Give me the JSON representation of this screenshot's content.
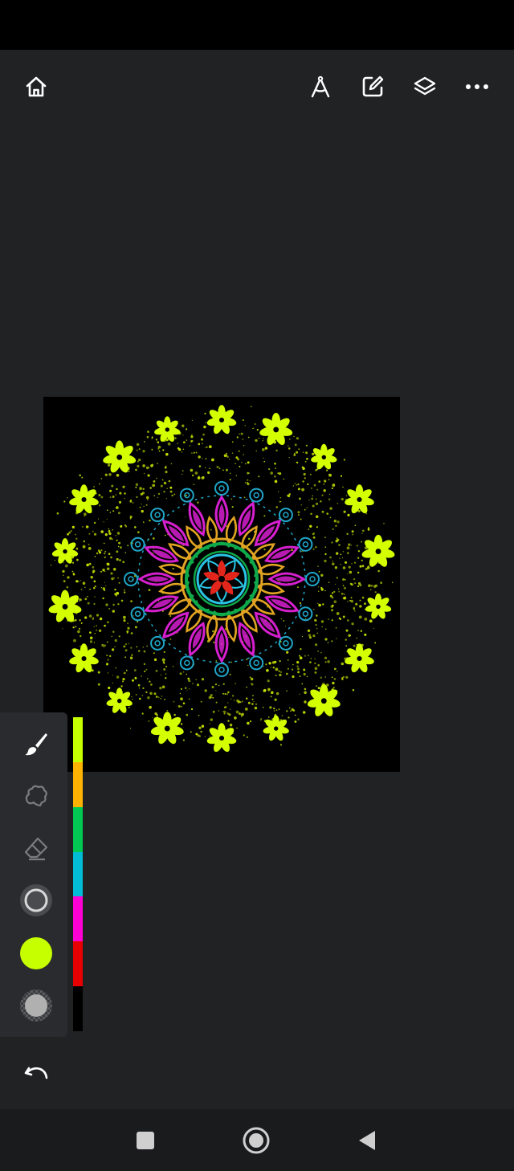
{
  "toolbar": {
    "icons": [
      "home-icon",
      "compass-icon",
      "edit-icon",
      "layers-icon",
      "more-icon"
    ]
  },
  "tools": {
    "items": [
      "brush-icon",
      "smudge-icon",
      "eraser-icon",
      "brush-size-icon",
      "active-color-icon",
      "opacity-icon"
    ],
    "active_color": "#c6ff00"
  },
  "palette": {
    "colors": [
      "#c6ff00",
      "#ffb300",
      "#00c853",
      "#00bcd4",
      "#ff00d4",
      "#e60000",
      "#000000"
    ]
  },
  "artwork": {
    "background": "#000000",
    "colors": {
      "flowers": "#d4ff00",
      "speckles": "#c6e000",
      "scroll": "#1fa6c9",
      "magenta": "#d61fcf",
      "gold": "#e0a322",
      "green": "#0fa84a",
      "cyan": "#29c4e6",
      "red": "#e3261b"
    }
  },
  "nav": {
    "icons": [
      "recents-icon",
      "home-circle-icon",
      "back-icon"
    ]
  }
}
